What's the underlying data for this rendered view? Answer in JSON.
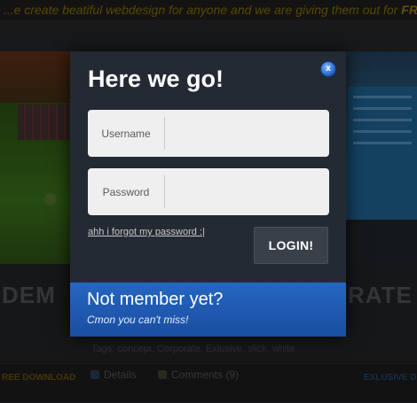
{
  "background": {
    "tagline": "...e create beatiful webdesign for anyone and we are giving them out for ",
    "tagline_emph": "FREE",
    "title_left": "DEM",
    "title_right": "RATE",
    "tags": "Tags: concept, Corporate, Exlusive, slick, white",
    "free_download": "REE DOWNLOAD",
    "details": "Details",
    "comments": "Comments (9)",
    "exclusive": "EXLUSIVE D"
  },
  "login_modal": {
    "title": "Here we go!",
    "close_label": "x",
    "username_label": "Username",
    "username_value": "",
    "password_label": "Password",
    "password_value": "",
    "forgot_link": "ahh i forgot my password :|",
    "login_button": "LOGIN!",
    "member_title": "Not member yet?",
    "member_subtitle": "Cmon you can't miss!"
  },
  "colors": {
    "modal_bg": "#242a33",
    "member_bar": "#2566c2",
    "accent_gold": "#7a6300"
  }
}
